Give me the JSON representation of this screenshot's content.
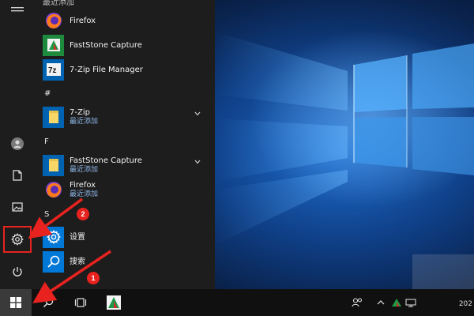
{
  "start_menu": {
    "section_top_label": "最近添加",
    "recent_apps": [
      {
        "name": "Firefox"
      },
      {
        "name": "FastStone Capture"
      },
      {
        "name": "7-Zip File Manager"
      }
    ],
    "groups": [
      {
        "letter": "#",
        "apps": [
          {
            "name": "7-Zip",
            "sub": "最近添加"
          }
        ]
      },
      {
        "letter": "F",
        "apps": [
          {
            "name": "FastStone Capture",
            "sub": "最近添加"
          },
          {
            "name": "Firefox",
            "sub": "最近添加"
          }
        ]
      },
      {
        "letter": "S",
        "apps": [
          {
            "name": "设置"
          },
          {
            "name": "搜索"
          }
        ]
      }
    ]
  },
  "annotations": {
    "badge_1": "1",
    "badge_2": "2"
  },
  "taskbar": {
    "clock": "202"
  },
  "colors": {
    "accent": "#0078d7",
    "annotation": "#e8231f",
    "menu_bg": "#1d1d1d",
    "taskbar_bg": "#101010"
  },
  "icons": {
    "rail": [
      "hamburger-icon",
      "user-icon",
      "document-icon",
      "pictures-icon",
      "settings-gear-icon",
      "power-icon"
    ],
    "taskbar": [
      "windows-logo-icon",
      "search-icon",
      "task-view-icon",
      "faststone-icon"
    ],
    "tray": [
      "people-icon",
      "chevron-up-icon",
      "faststone-tray-icon",
      "network-icon"
    ]
  }
}
